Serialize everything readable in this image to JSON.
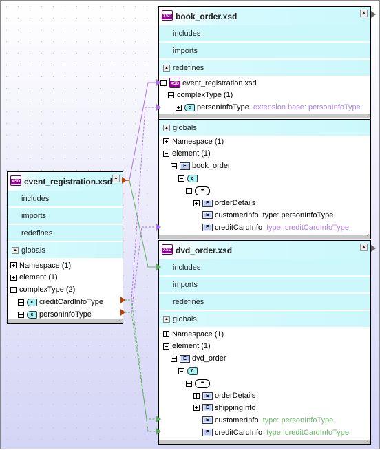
{
  "colors": {
    "purple": "#b070f0",
    "green": "#60b060",
    "orange": "#c04000",
    "header_bg": "#ccf8fc"
  },
  "event_registration": {
    "title": "event_registration.xsd",
    "sections": [
      "includes",
      "imports",
      "redefines",
      "globals"
    ],
    "rows": [
      {
        "label": "Namespace (1)",
        "lvl": 0,
        "tg": "plus"
      },
      {
        "label": "element (1)",
        "lvl": 0,
        "tg": "plus"
      },
      {
        "label": "complexType (2)",
        "lvl": 0,
        "tg": "minus"
      },
      {
        "label": "creditCardInfoType",
        "lvl": 1,
        "tg": "plus",
        "icon": "C"
      },
      {
        "label": "personInfoType",
        "lvl": 1,
        "tg": "plus",
        "icon": "C"
      }
    ]
  },
  "book_order": {
    "title": "book_order.xsd",
    "sections": [
      "includes",
      "imports",
      "redefines"
    ],
    "rows": [
      {
        "label": "event_registration.xsd",
        "lvl": 0,
        "tg": "minus",
        "icon": "xsdi"
      },
      {
        "label": "complexType (1)",
        "lvl": 1,
        "tg": "minus"
      },
      {
        "label": "personInfoType",
        "lvl": 2,
        "tg": "plus",
        "icon": "C",
        "note": "extension base: personInfoType",
        "noteColor": "#b080e8"
      }
    ],
    "globals_label": "globals",
    "globals_rows": [
      {
        "label": "Namespace (1)",
        "lvl": 0,
        "tg": "plus"
      },
      {
        "label": "element (1)",
        "lvl": 0,
        "tg": "minus"
      },
      {
        "label": "book_order",
        "lvl": 1,
        "tg": "minus",
        "icon": "E"
      },
      {
        "label": "",
        "lvl": 2,
        "tg": "minus",
        "icon": "C"
      },
      {
        "label": "",
        "lvl": 3,
        "tg": "minus",
        "icon": "seq"
      },
      {
        "label": "orderDetails",
        "lvl": 4,
        "tg": "plus",
        "icon": "E"
      },
      {
        "label": "customerInfo",
        "lvl": 4,
        "tg": "none",
        "icon": "E",
        "note": "type: personInfoType",
        "noteColor": "#000000"
      },
      {
        "label": "creditCardInfo",
        "lvl": 4,
        "tg": "none",
        "icon": "E",
        "note": "type: creditCardInfoType",
        "noteColor": "#b080e8"
      }
    ]
  },
  "dvd_order": {
    "title": "dvd_order.xsd",
    "sections": [
      "includes",
      "imports",
      "redefines",
      "globals"
    ],
    "rows": [
      {
        "label": "Namespace (1)",
        "lvl": 0,
        "tg": "plus"
      },
      {
        "label": "element (1)",
        "lvl": 0,
        "tg": "minus"
      },
      {
        "label": "dvd_order",
        "lvl": 1,
        "tg": "minus",
        "icon": "E"
      },
      {
        "label": "",
        "lvl": 2,
        "tg": "minus",
        "icon": "C"
      },
      {
        "label": "",
        "lvl": 3,
        "tg": "minus",
        "icon": "seq"
      },
      {
        "label": "orderDetails",
        "lvl": 4,
        "tg": "plus",
        "icon": "E"
      },
      {
        "label": "shippingInfo",
        "lvl": 4,
        "tg": "plus",
        "icon": "E"
      },
      {
        "label": "customerInfo",
        "lvl": 4,
        "tg": "none",
        "icon": "E",
        "note": "type: personInfoType",
        "noteColor": "#70b870"
      },
      {
        "label": "creditCardInfo",
        "lvl": 4,
        "tg": "none",
        "icon": "E",
        "note": "type: creditCardInfoType",
        "noteColor": "#70b870"
      }
    ]
  },
  "icons": {
    "E": "E",
    "C": "c",
    "seq": "•••"
  }
}
